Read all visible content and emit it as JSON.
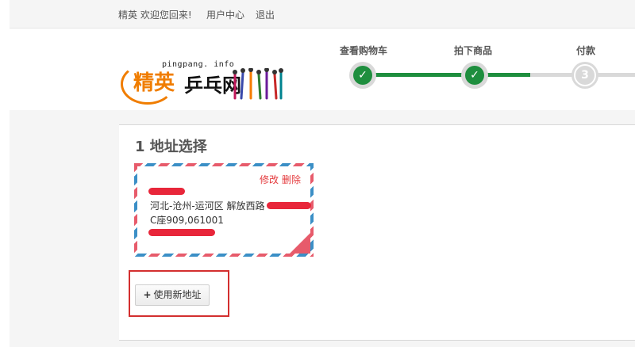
{
  "topbar": {
    "greeting": "精英 欢迎您回来!",
    "user_center": "用户中心",
    "logout": "退出"
  },
  "logo": {
    "site": "pingpang. info",
    "name_part1": "精英",
    "name_part2": "乒乓网"
  },
  "steps": [
    {
      "label": "查看购物车",
      "status": "done",
      "icon": "check-icon"
    },
    {
      "label": "拍下商品",
      "status": "done",
      "icon": "check-icon"
    },
    {
      "label": "付款",
      "status": "pending",
      "number": "3"
    }
  ],
  "colors": {
    "progress": "#1e8e3e",
    "accent": "#e4393c",
    "stripe_red": "#e75b6b",
    "stripe_blue": "#3b8fc6"
  },
  "address_section": {
    "title": "1 地址选择",
    "card": {
      "edit": "修改",
      "delete": "删除",
      "line1": "河北-沧州-运河区 解放西路",
      "line2": "C座909,061001",
      "selected_icon": "check-icon"
    },
    "new_address_button": "使用新地址"
  }
}
